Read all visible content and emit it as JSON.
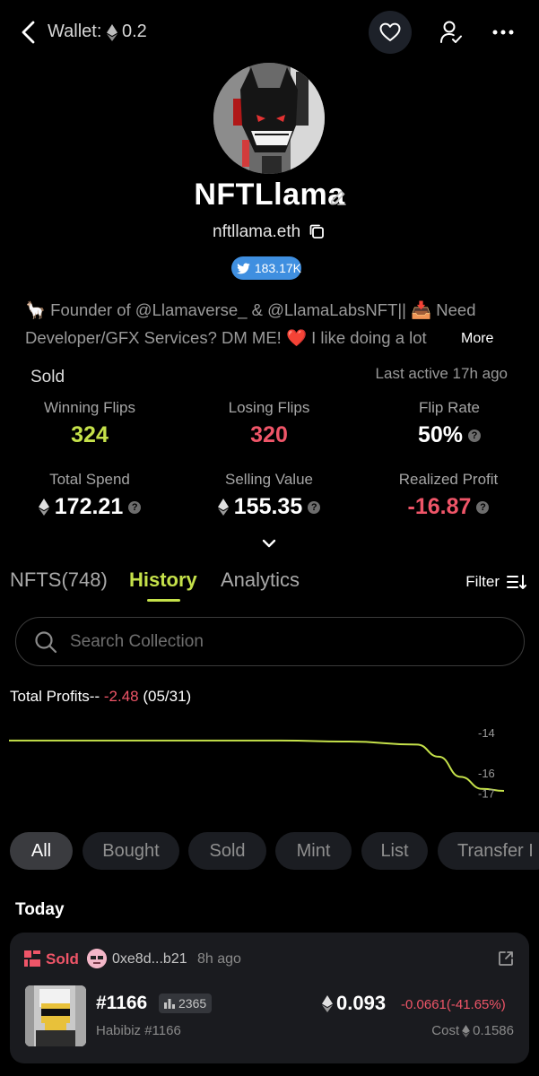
{
  "header": {
    "wallet_label": "Wallet:",
    "wallet_value": "0.2"
  },
  "profile": {
    "name": "NFTLlama",
    "ens": "nftllama.eth",
    "twitter_followers": "183.17K",
    "bio_line1": "🦙 Founder of @Llamaverse_ & @LlamaLabsNFT|| 📥 Need",
    "bio_line2": "Developer/GFX Services? DM ME! ❤️ I like doing a lot",
    "bio_more": "More"
  },
  "stats": {
    "sold_label": "Sold",
    "last_active": "Last active 17h ago",
    "winning_flips_label": "Winning Flips",
    "winning_flips_value": "324",
    "losing_flips_label": "Losing Flips",
    "losing_flips_value": "320",
    "flip_rate_label": "Flip Rate",
    "flip_rate_value": "50%",
    "total_spend_label": "Total Spend",
    "total_spend_value": "172.21",
    "selling_value_label": "Selling Value",
    "selling_value_value": "155.35",
    "realized_profit_label": "Realized Profit",
    "realized_profit_value": "-16.87"
  },
  "tabs": {
    "nfts": "NFTS(748)",
    "history": "History",
    "analytics": "Analytics",
    "filter": "Filter"
  },
  "search": {
    "placeholder": "Search Collection"
  },
  "profits": {
    "label": "Total Profits-- ",
    "value": "-2.48",
    "date": "(05/31)"
  },
  "chart_data": {
    "type": "line",
    "y_ticks": [
      "-14",
      "-16",
      "-17"
    ],
    "series": [
      {
        "values": [
          -14.4,
          -14.4,
          -14.4,
          -14.4,
          -14.4,
          -14.45,
          -14.6,
          -15.2,
          -16.2,
          -16.8,
          -16.9
        ]
      }
    ],
    "line_color": "#c5e14a"
  },
  "activity_filters": [
    "All",
    "Bought",
    "Sold",
    "Mint",
    "List",
    "Transfer I"
  ],
  "section_title": "Today",
  "activity": {
    "type": "Sold",
    "buyer": "0xe8d...b21",
    "time": "8h ago",
    "token_id": "#1166",
    "rank": "2365",
    "collection": "Habibiz #1166",
    "price": "0.093",
    "price_change": "-0.0661(-41.65%)",
    "cost_label": "Cost",
    "cost_value": "0.1586"
  },
  "colors": {
    "accent_green": "#c5e14a",
    "negative_red": "#ef5568",
    "twitter_blue": "#3f8fe0"
  }
}
